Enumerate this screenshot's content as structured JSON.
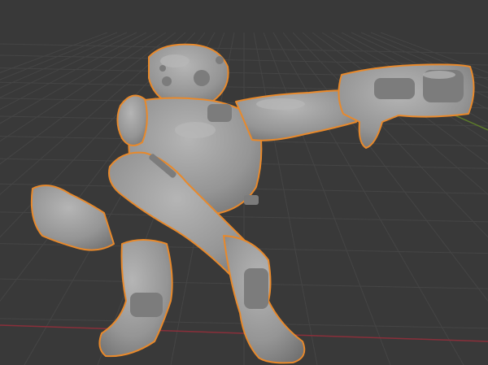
{
  "viewport": {
    "background": "#393939",
    "grid_color": "#454545",
    "x_axis_color": "#8a2f3a",
    "y_axis_color": "#5c7a2a"
  },
  "model": {
    "fill_color": "#9a9a9a",
    "shade_color": "#777777",
    "highlight_color": "#bdbdbd",
    "outline_color": "#e8892b",
    "selected": true
  }
}
